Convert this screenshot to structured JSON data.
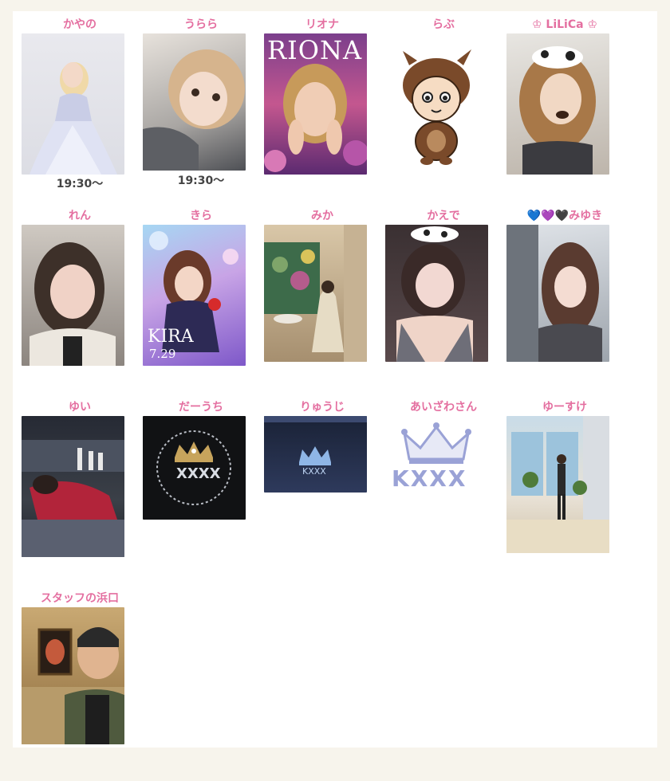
{
  "cast": [
    {
      "name": "かやの",
      "time": "19:30〜"
    },
    {
      "name": "うらら",
      "time": "19:30〜"
    },
    {
      "name": "リオナ",
      "photo_text": "RIONA"
    },
    {
      "name": "らぶ"
    },
    {
      "name": "♔ LiLiCa ♔"
    },
    {
      "name": "れん"
    },
    {
      "name": "きら",
      "photo_text": "KIRA",
      "photo_date": "7.29"
    },
    {
      "name": "みか"
    },
    {
      "name": "かえで"
    },
    {
      "name": "💙💜🖤みゆき"
    },
    {
      "name": "ゆい"
    },
    {
      "name": "だーうち",
      "photo_text": "XXXX"
    },
    {
      "name": "りゅうじ",
      "photo_text": "KXXX"
    },
    {
      "name": "あいざわさん",
      "photo_text": "KXXX"
    },
    {
      "name": "ゆーすけ"
    },
    {
      "name": "スタッフの浜口"
    }
  ],
  "colors": {
    "name_pink": "#e46fa0",
    "background": "#f7f4ec",
    "logo_lavender": "#9aa2d6"
  }
}
